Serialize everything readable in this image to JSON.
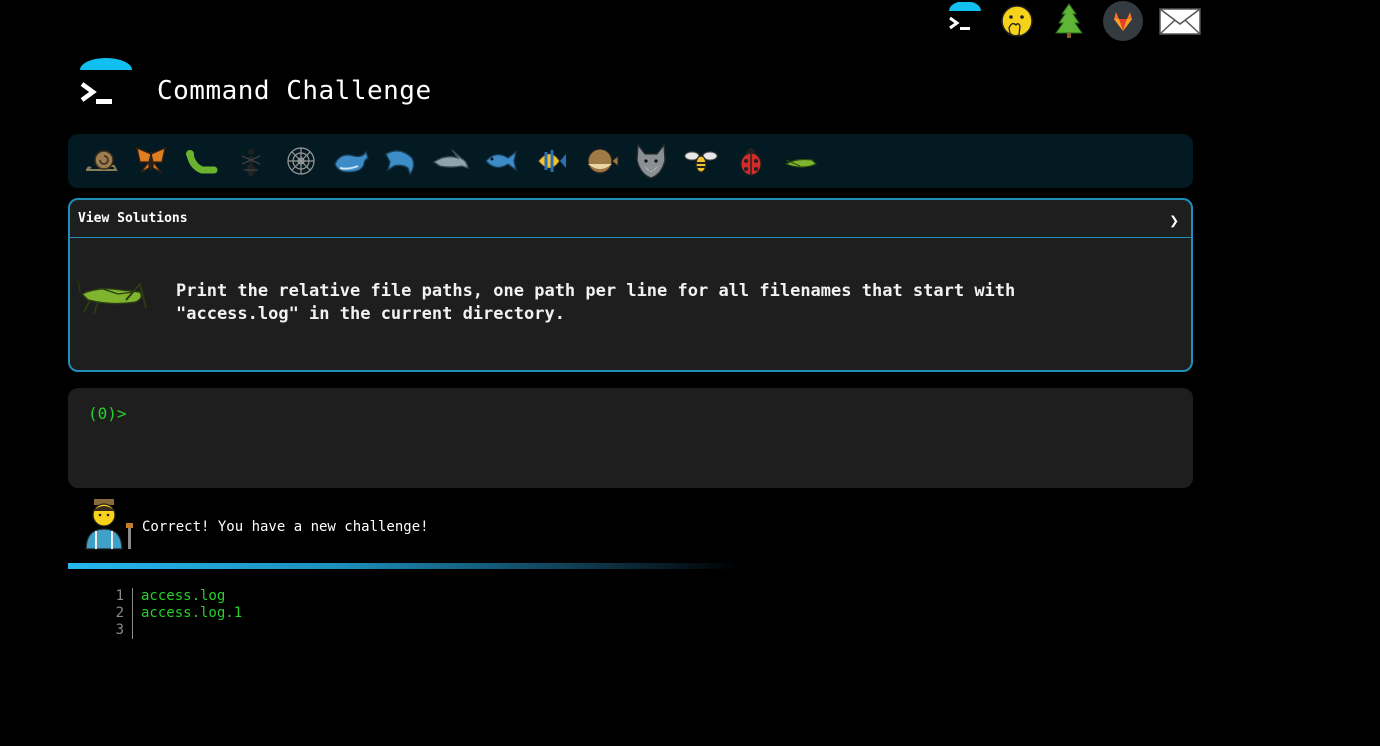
{
  "top_icons": [
    "terminal-icon",
    "face-with-hand-over-mouth-icon",
    "evergreen-tree-icon",
    "gitlab-icon",
    "envelope-icon"
  ],
  "header": {
    "title": "Command Challenge"
  },
  "animals": [
    "snail-icon",
    "butterfly-icon",
    "bug-icon",
    "ant-icon",
    "spider-web-icon",
    "whale-icon",
    "dolphin-icon",
    "shark-icon",
    "fish-icon",
    "tropical-fish-icon",
    "blowfish-icon",
    "wolf-icon",
    "bee-icon",
    "ladybug-icon",
    "cricket-icon"
  ],
  "challenge": {
    "header_label": "View Solutions",
    "description_line1": "Print the relative file paths, one path per line for all filenames that start with",
    "description_line2": "\"access.log\" in the current directory."
  },
  "terminal": {
    "prompt": "(0)>"
  },
  "result": {
    "message": "Correct! You have a new challenge!"
  },
  "output": {
    "lines": [
      {
        "num": "1",
        "text": "access.log"
      },
      {
        "num": "2",
        "text": "access.log.1"
      },
      {
        "num": "3",
        "text": ""
      }
    ]
  },
  "colors": {
    "accent": "#1f8fb8",
    "prompt_green": "#27d02b",
    "panel": "#1e1e1e",
    "animal_bar": "#041a22"
  }
}
